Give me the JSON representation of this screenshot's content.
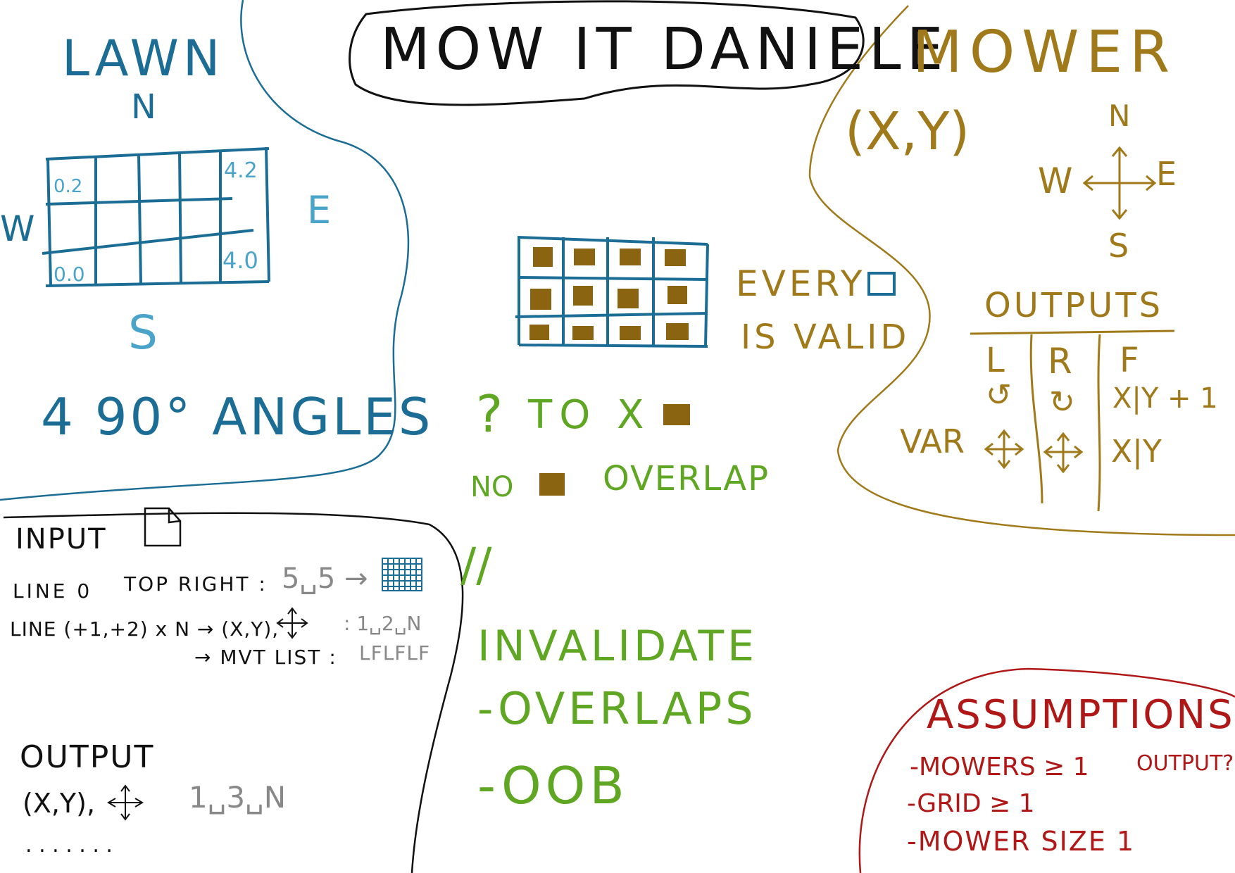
{
  "title": "MOW IT DANIELE",
  "lawn": {
    "heading": "LAWN",
    "north": "N",
    "south": "S",
    "east": "E",
    "west": "W",
    "cell_labels": {
      "top_left": "0.2",
      "top_right": "4.2",
      "bottom_left": "0.0",
      "bottom_right": "4.0"
    },
    "angles_note": "4 90° ANGLES"
  },
  "middle": {
    "every_line1": "EVERY",
    "every_line2": "IS VALID",
    "question": "?",
    "to_x": "TO X",
    "no": "NO",
    "overlap": "OVERLAP",
    "parallel": "//",
    "invalidate": "INVALIDATE",
    "invalidate_items": [
      "-OVERLAPS",
      "-OOB"
    ]
  },
  "mower": {
    "heading": "MOWER",
    "coords": "(X,Y)",
    "compass": {
      "n": "N",
      "s": "S",
      "e": "E",
      "w": "W"
    },
    "outputs_heading": "OUTPUTS",
    "columns": [
      "L",
      "R",
      "F"
    ],
    "row1": [
      "↺",
      "↻",
      "X|Y + 1"
    ],
    "row2_label": "VAR",
    "row2_last": "X|Y"
  },
  "input": {
    "heading": "INPUT",
    "line0_label": "LINE 0",
    "line0_desc": "TOP RIGHT :",
    "line0_example": "5␣5 →",
    "line_n_label": "LINE (+1,+2) x N → (X,Y),",
    "line_n_example": ": 1␣2␣N",
    "mvt_label": "→ MVT LIST :",
    "mvt_example": "LFLFLF"
  },
  "output": {
    "heading": "OUTPUT",
    "format": "(X,Y),",
    "example": "1␣3␣N",
    "dots": ". . . . . . ."
  },
  "assumptions": {
    "heading": "ASSUMPTIONS",
    "items": [
      "-MOWERS ≥ 1",
      "-GRID ≥ 1",
      "-MOWER SIZE 1"
    ],
    "side_note": "OUTPUT?"
  },
  "colors": {
    "lawn": "#1c6d95",
    "mower": "#a07a1a",
    "fill": "#8a6410",
    "green": "#5fa722",
    "assumptions": "#b01818"
  }
}
